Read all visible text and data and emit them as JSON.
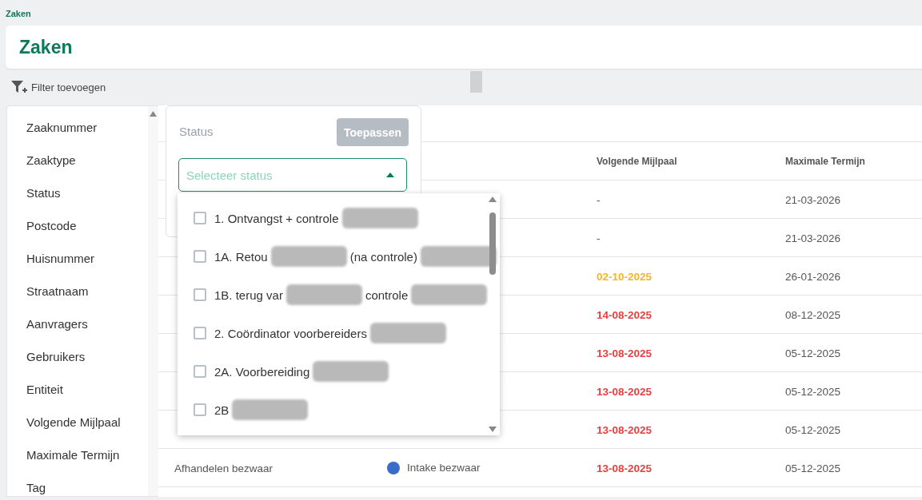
{
  "breadcrumb": "Zaken",
  "page_title": "Zaken",
  "filter_button": "Filter toevoegen",
  "column_picker": {
    "items": [
      "Zaaknummer",
      "Zaaktype",
      "Status",
      "Postcode",
      "Huisnummer",
      "Straatnaam",
      "Aanvragers",
      "Gebruikers",
      "Entiteit",
      "Volgende Mijlpaal",
      "Maximale Termijn",
      "Tag"
    ]
  },
  "table": {
    "columns": [
      "Volgende Mijlpaal",
      "Maximale Termijn"
    ],
    "rows": [
      {
        "milestone": "-",
        "due_soon": false,
        "overdue": false,
        "deadline": "21-03-2026"
      },
      {
        "milestone": "-",
        "due_soon": false,
        "overdue": false,
        "deadline": "21-03-2026"
      },
      {
        "milestone": "02-10-2025",
        "due_soon": true,
        "overdue": false,
        "deadline": "26-01-2026"
      },
      {
        "milestone": "14-08-2025",
        "due_soon": false,
        "overdue": true,
        "deadline": "08-12-2025"
      },
      {
        "milestone": "13-08-2025",
        "due_soon": false,
        "overdue": true,
        "deadline": "05-12-2025"
      },
      {
        "milestone": "13-08-2025",
        "due_soon": false,
        "overdue": true,
        "deadline": "05-12-2025"
      },
      {
        "milestone": "13-08-2025",
        "due_soon": false,
        "overdue": true,
        "deadline": "05-12-2025"
      },
      {
        "column_1": "Afhandelen bezwaar",
        "status": "Intake bezwaar",
        "color": "#3a6bc9",
        "milestone": "13-08-2025",
        "due_soon": false,
        "overdue": true,
        "deadline": "05-12-2025"
      }
    ]
  },
  "status_filter": {
    "label": "Status",
    "apply_button": "Toepassen",
    "apply_disabled": true,
    "select": {
      "placeholder": "Selecteer status",
      "expanded": true
    },
    "options": [
      {
        "checked": false,
        "segments": [
          {
            "kind": "text",
            "text": "1. Ontvangst + controle"
          },
          {
            "kind": "redacted"
          }
        ]
      },
      {
        "checked": false,
        "segments": [
          {
            "kind": "text",
            "text": "1A. Retou"
          },
          {
            "kind": "redacted"
          },
          {
            "kind": "text",
            "text": "(na controle)"
          },
          {
            "kind": "redacted"
          }
        ]
      },
      {
        "checked": false,
        "segments": [
          {
            "kind": "text",
            "text": "1B. terug var"
          },
          {
            "kind": "redacted"
          },
          {
            "kind": "text",
            "text": "controle"
          },
          {
            "kind": "redacted"
          }
        ]
      },
      {
        "checked": false,
        "segments": [
          {
            "kind": "text",
            "text": "2. Coördinator voorbereiders"
          },
          {
            "kind": "redacted"
          }
        ]
      },
      {
        "checked": false,
        "segments": [
          {
            "kind": "text",
            "text": "2A. Voorbereiding"
          },
          {
            "kind": "redacted"
          }
        ]
      },
      {
        "checked": false,
        "segments": [
          {
            "kind": "text",
            "text": "2B"
          },
          {
            "kind": "redacted"
          }
        ]
      }
    ]
  }
}
